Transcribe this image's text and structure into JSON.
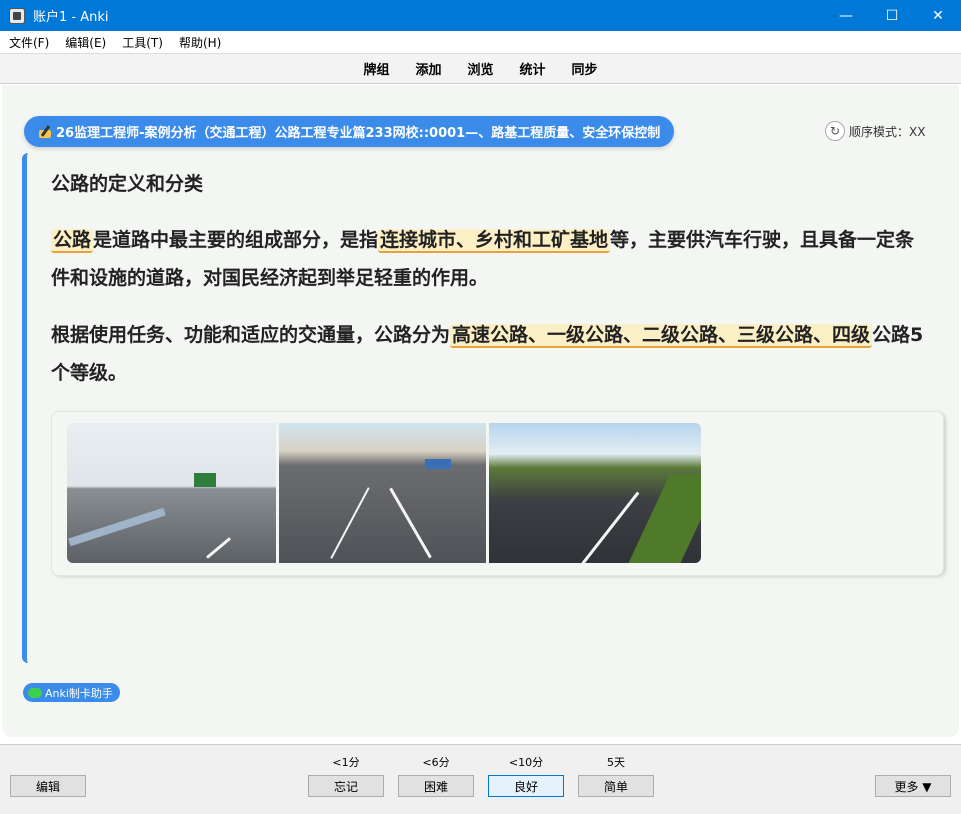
{
  "window": {
    "title": "账户1 - Anki",
    "controls": {
      "minimize": "—",
      "maximize": "☐",
      "close": "✕"
    }
  },
  "menu": [
    "文件(F)",
    "编辑(E)",
    "工具(T)",
    "帮助(H)"
  ],
  "toolbar": [
    "牌组",
    "添加",
    "浏览",
    "统计",
    "同步"
  ],
  "card": {
    "deck_path": "26监理工程师-案例分析（交通工程）公路工程专业篇233网校::0001—、路基工程质量、安全环保控制",
    "order_mode": "顺序模式：XX",
    "heading": "公路的定义和分类",
    "para1": {
      "hl1": "公路",
      "t1": "是道路中最主要的组成部分，是指",
      "hl2": "连接城市、乡村和工矿基地",
      "t2": "等，主要供汽车行驶，且具备一定条件和设施的道路，对国民经济起到举足轻重的作用。"
    },
    "para2": {
      "t1": "根据使用任务、功能和适应的交通量，公路分为",
      "hl1": "高速公路、一级公路、二级公路、三级公路、四级",
      "t2": "公路5个等级。"
    },
    "assistant": "Anki制卡助手"
  },
  "answer": {
    "intervals": [
      "<1分",
      "<6分",
      "<10分",
      "5天"
    ],
    "buttons": [
      "忘记",
      "困难",
      "良好",
      "简单"
    ],
    "edit": "编辑",
    "more": "更多 ▼"
  }
}
